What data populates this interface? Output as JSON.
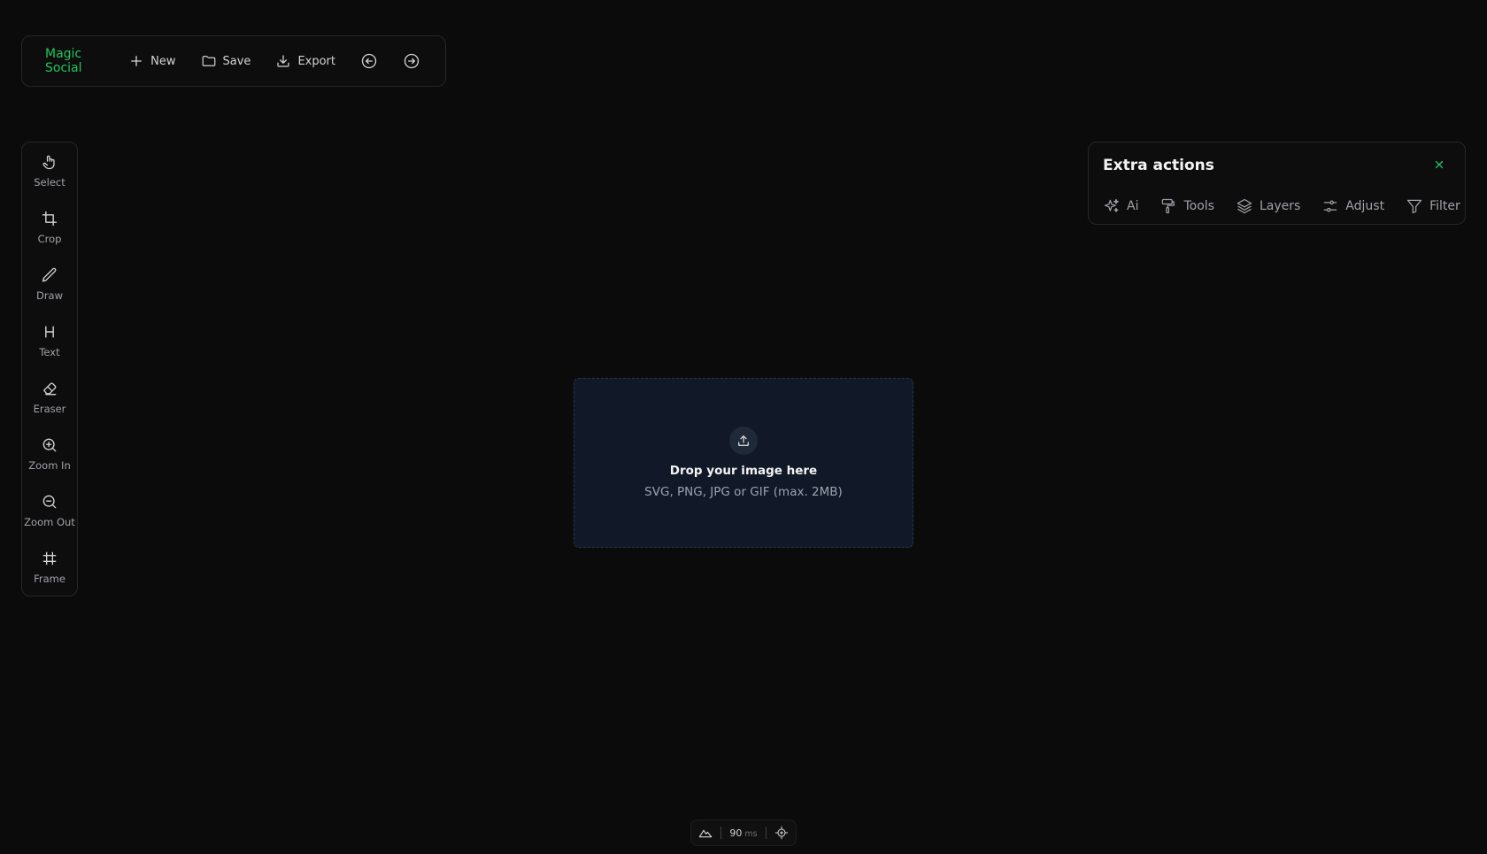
{
  "topbar": {
    "brand": "Magic Social",
    "new_label": "New",
    "save_label": "Save",
    "export_label": "Export",
    "undo_icon": "arrow-left-circle-icon",
    "redo_icon": "arrow-right-circle-icon",
    "brand_color": "#22c55e"
  },
  "tools": [
    {
      "label": "Select",
      "icon": "hand-pointer-icon"
    },
    {
      "label": "Crop",
      "icon": "crop-icon"
    },
    {
      "label": "Draw",
      "icon": "pencil-icon"
    },
    {
      "label": "Text",
      "icon": "heading-icon"
    },
    {
      "label": "Eraser",
      "icon": "eraser-icon"
    },
    {
      "label": "Zoom In",
      "icon": "zoom-in-icon"
    },
    {
      "label": "Zoom Out",
      "icon": "zoom-out-icon"
    },
    {
      "label": "Frame",
      "icon": "frame-icon"
    }
  ],
  "extra": {
    "title": "Extra actions",
    "tabs": [
      {
        "label": "Ai",
        "icon": "sparkles-icon"
      },
      {
        "label": "Tools",
        "icon": "paint-roller-icon"
      },
      {
        "label": "Layers",
        "icon": "layers-icon"
      },
      {
        "label": "Adjust",
        "icon": "sliders-icon"
      },
      {
        "label": "Filter",
        "icon": "filter-icon"
      }
    ]
  },
  "dropzone": {
    "title": "Drop your image here",
    "subtitle": "SVG, PNG, JPG or GIF (max. 2MB)"
  },
  "status": {
    "value": "90",
    "unit": "ms"
  }
}
